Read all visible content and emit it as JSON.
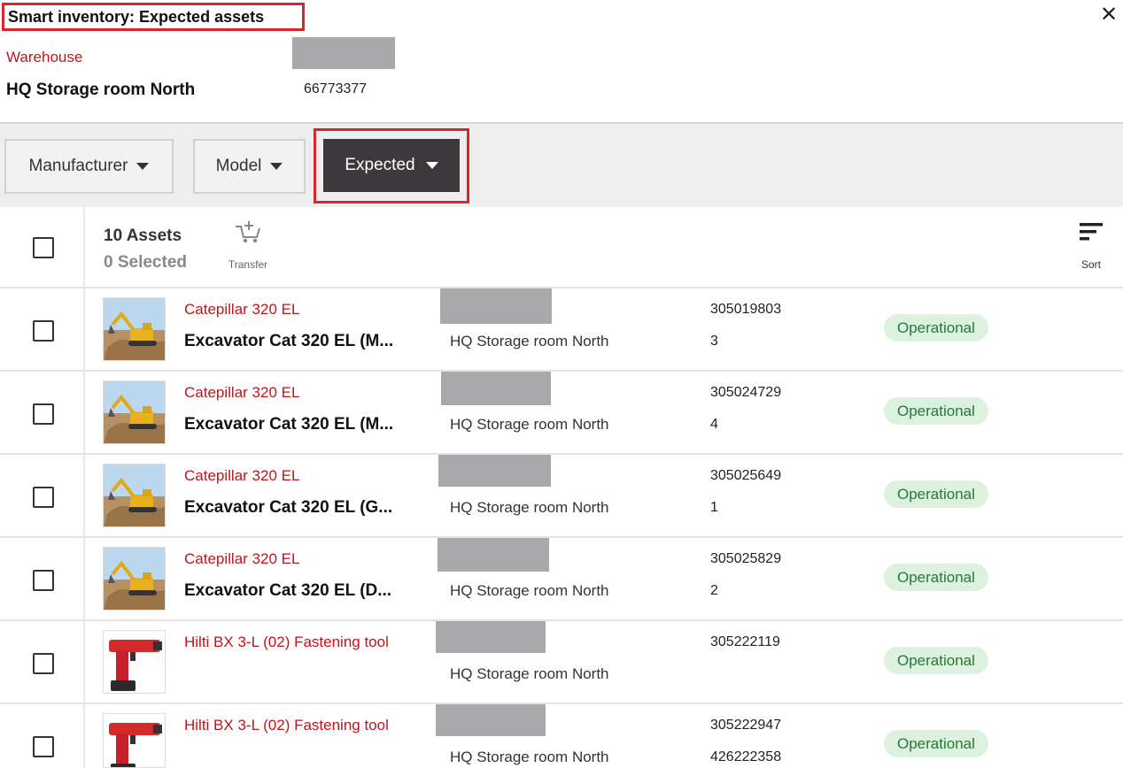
{
  "header": {
    "title": "Smart inventory: Expected assets",
    "close_icon": "close-icon",
    "warehouse_label": "Warehouse",
    "warehouse_name": "HQ Storage room North",
    "warehouse_id": "66773377"
  },
  "filters": {
    "manufacturer": "Manufacturer",
    "model": "Model",
    "expected": "Expected"
  },
  "list_header": {
    "assets_count": "10 Assets",
    "selected_count": "0 Selected",
    "transfer_label": "Transfer",
    "sort_label": "Sort"
  },
  "colors": {
    "brand_red": "#c0151b",
    "highlight_red": "#d8262d",
    "status_bg": "#dcf2df",
    "status_text": "#237a38",
    "active_filter_bg": "#3d383b"
  },
  "rows": [
    {
      "image": "excavator-image",
      "model": "Catepillar 320 EL",
      "name": "Excavator Cat 320 EL (M...",
      "location": "HQ Storage room North",
      "number": "305019803",
      "qty": "3",
      "status": "Operational"
    },
    {
      "image": "excavator-image",
      "model": "Catepillar 320 EL",
      "name": "Excavator Cat 320 EL (M...",
      "location": "HQ Storage room North",
      "number": "305024729",
      "qty": "4",
      "status": "Operational"
    },
    {
      "image": "excavator-image",
      "model": "Catepillar 320 EL",
      "name": "Excavator Cat 320 EL (G...",
      "location": "HQ Storage room North",
      "number": "305025649",
      "qty": "1",
      "status": "Operational"
    },
    {
      "image": "excavator-image",
      "model": "Catepillar 320 EL",
      "name": "Excavator Cat 320 EL (D...",
      "location": "HQ Storage room North",
      "number": "305025829",
      "qty": "2",
      "status": "Operational"
    },
    {
      "image": "fastening-tool-image",
      "model": "Hilti BX 3-L (02) Fastening tool",
      "name": "",
      "location": "HQ Storage room North",
      "number": "305222119",
      "qty": "",
      "status": "Operational"
    },
    {
      "image": "fastening-tool-image",
      "model": "Hilti BX 3-L (02) Fastening tool",
      "name": "",
      "location": "HQ Storage room North",
      "number": "305222947",
      "qty": "426222358",
      "status": "Operational"
    }
  ]
}
